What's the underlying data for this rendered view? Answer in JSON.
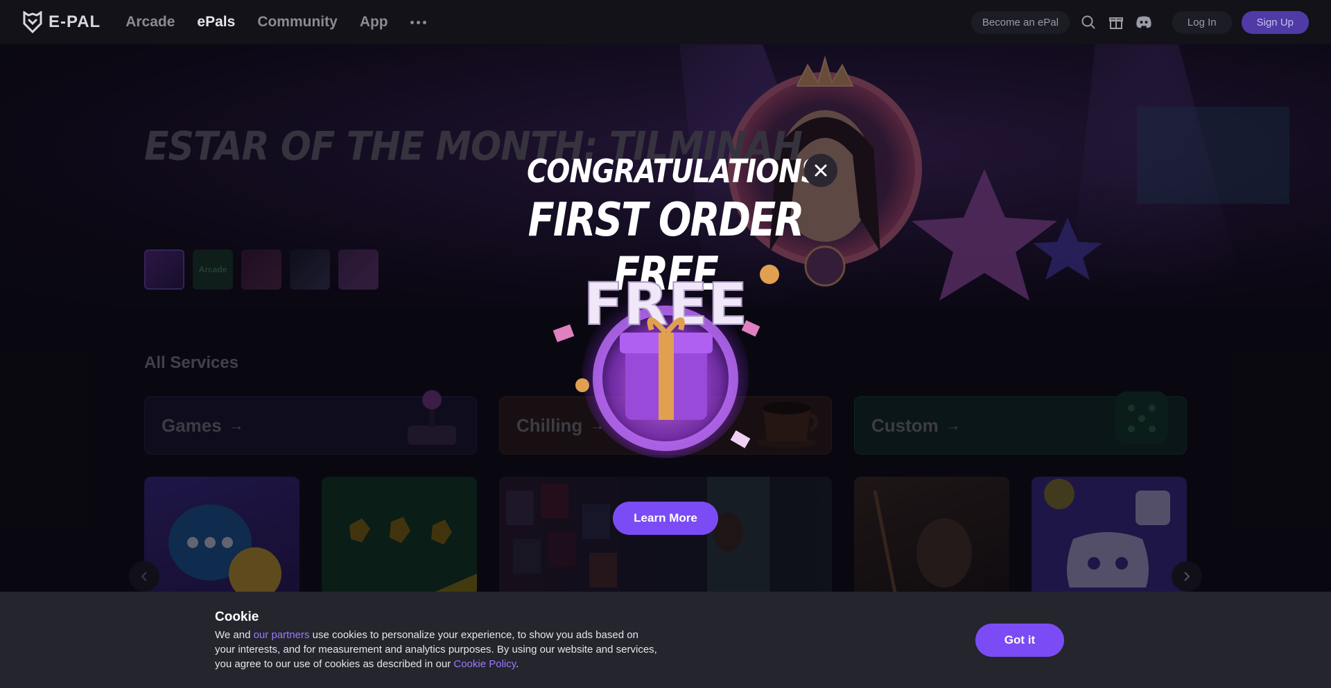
{
  "header": {
    "logo_text": "E-PAL",
    "nav": [
      "Arcade",
      "ePals",
      "Community",
      "App"
    ],
    "active_nav": "ePals",
    "become_label": "Become an ePal",
    "login_label": "Log In",
    "signup_label": "Sign Up",
    "icons": [
      "search-icon",
      "gift-icon",
      "discord-icon"
    ]
  },
  "hero": {
    "title": "ESTAR OF THE MONTH: TILMINAH",
    "thumbnails": [
      "Arcade"
    ]
  },
  "services": {
    "section_title": "All Services",
    "items": [
      {
        "label": "Games",
        "arrow": "→"
      },
      {
        "label": "Chilling",
        "arrow": "→"
      },
      {
        "label": "Custom",
        "arrow": "→"
      }
    ]
  },
  "promo": {
    "congrats": "CONGRATULATIONS!",
    "headline": "FIRST ORDER FREE",
    "badge": "FREE",
    "cta": "Learn More"
  },
  "cookie": {
    "title": "Cookie",
    "text_prefix": "We and ",
    "partners_link": "our partners",
    "text_mid": " use cookies to personalize your experience, to show you ads based on your interests, and for measurement and analytics purposes. By using our website and services, you agree to our use of cookies as described in our ",
    "policy_link": "Cookie Policy",
    "text_suffix": ".",
    "button": "Got it"
  },
  "colors": {
    "accent": "#7b4cf5",
    "header_bg": "#121218",
    "cookie_bg": "#25252e",
    "games": "#1a1530",
    "chilling": "#2a1c14",
    "custom": "#0f2a22"
  }
}
